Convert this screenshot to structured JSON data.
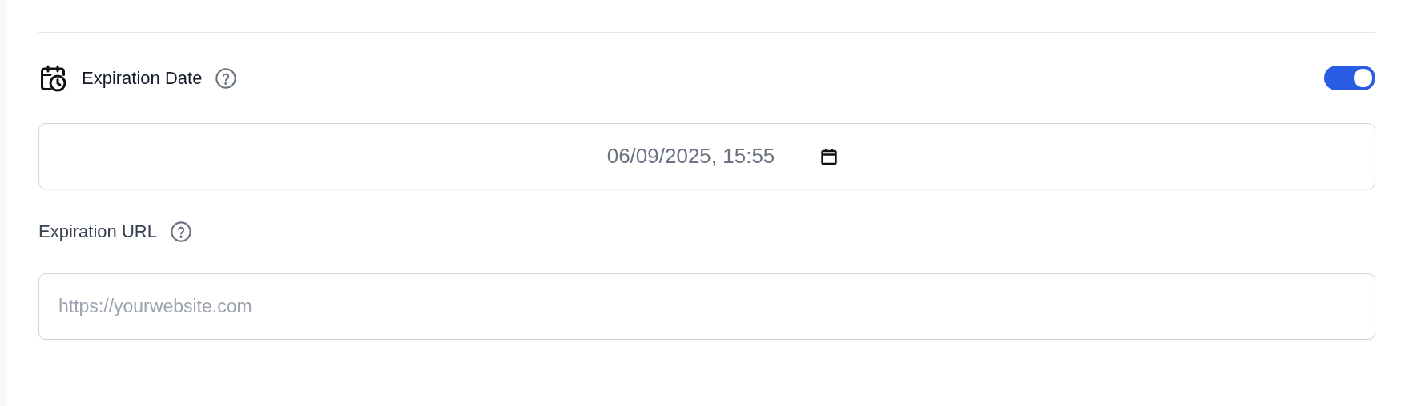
{
  "expiration_date": {
    "label": "Expiration Date",
    "enabled": true,
    "value": "06/09/2025, 15:55"
  },
  "expiration_url": {
    "label": "Expiration URL",
    "placeholder": "https://yourwebsite.com"
  }
}
